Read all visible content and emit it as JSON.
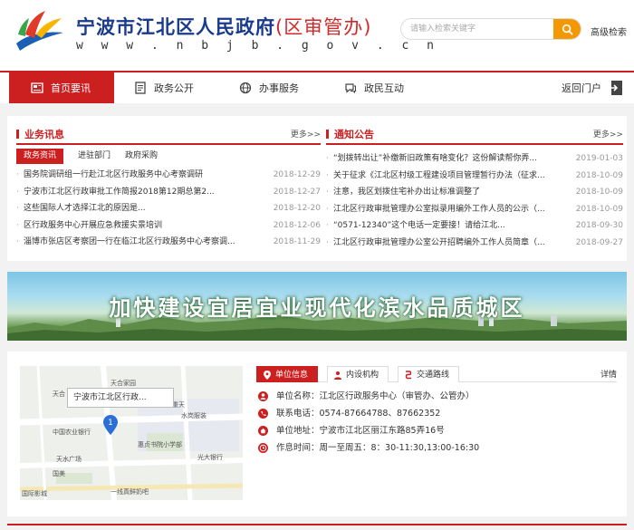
{
  "header": {
    "title": "宁波市江北区人民政府",
    "dept": "(区审管办)",
    "url": "w w w . n b j b . g o v . c n",
    "search_placeholder": "请输入检索关键字",
    "adv_search": "高级检索"
  },
  "nav": {
    "items": [
      {
        "label": "首页要讯",
        "active": true,
        "icon": "newspaper-icon"
      },
      {
        "label": "政务公开",
        "active": false,
        "icon": "document-icon"
      },
      {
        "label": "办事服务",
        "active": false,
        "icon": "globe-icon"
      },
      {
        "label": "政民互动",
        "active": false,
        "icon": "chat-icon"
      }
    ],
    "back": "返回门户"
  },
  "business_news": {
    "title": "业务讯息",
    "more": "更多>>",
    "tabs": [
      "政务资讯",
      "进驻部门",
      "政府采购"
    ],
    "items": [
      {
        "text": "国务院调研组一行赴江北区行政服务中心考察调研",
        "date": "2018-12-29"
      },
      {
        "text": "宁波市江北区行政审批工作简报2018第12期总第2...",
        "date": "2018-12-27"
      },
      {
        "text": "这些国际人才选择江北的原因是...",
        "date": "2018-12-20"
      },
      {
        "text": "区行政服务中心开展应急救援实景培训",
        "date": "2018-12-06"
      },
      {
        "text": "淄博市张店区考察团一行在临江北区行政服务中心考察调...",
        "date": "2018-11-29"
      }
    ]
  },
  "notices": {
    "title": "通知公告",
    "more": "更多>>",
    "items": [
      {
        "text": "“划拨转出让”补缴新旧政策有啥变化？这份解读帮你弄...",
        "date": "2019-01-03"
      },
      {
        "text": "关于征求《江北区村级工程建设项目管理暂行办法（征求...",
        "date": "2018-10-09"
      },
      {
        "text": "注意，我区划拨住宅补办出让标准调整了",
        "date": "2018-10-09"
      },
      {
        "text": "江北区行政审批管理办公室拟录用编外工作人员的公示（...",
        "date": "2018-10-09"
      },
      {
        "text": "“0571-12340”这个电话一定要接！请给江北...",
        "date": "2018-09-30"
      },
      {
        "text": "江北区行政审批管理办公室公开招聘编外工作人员简章（...",
        "date": "2018-09-27"
      }
    ]
  },
  "banner": {
    "text": "加快建设宜居宜业现代化滨水品质城区"
  },
  "map": {
    "popup": "宁波市江北区行政...",
    "labels": [
      "天合家园",
      "天合",
      "中国农业银行",
      "天水广场",
      "国美",
      "惠贞书院小学部",
      "水岗服装",
      "光大银行",
      "一线真鲜奶吧",
      "那年重天",
      "国际影城"
    ]
  },
  "info": {
    "tabs": [
      "单位信息",
      "内设机构",
      "交通路线"
    ],
    "detail": "详情",
    "rows": [
      {
        "label": "单位名称：",
        "value": "江北区行政服务中心（审管办、公管办）"
      },
      {
        "label": "联系电话：",
        "value": "0574-87664788、87662352"
      },
      {
        "label": "单位地址：",
        "value": "宁波市江北区丽江东路85弄16号"
      },
      {
        "label": "作息时间：",
        "value": "周一至周五：8：30-11:30,13:00-16:30"
      }
    ]
  },
  "colors": {
    "accent": "#cc1f1f",
    "search_button": "#f39800",
    "title_blue": "#1a3a8c"
  }
}
